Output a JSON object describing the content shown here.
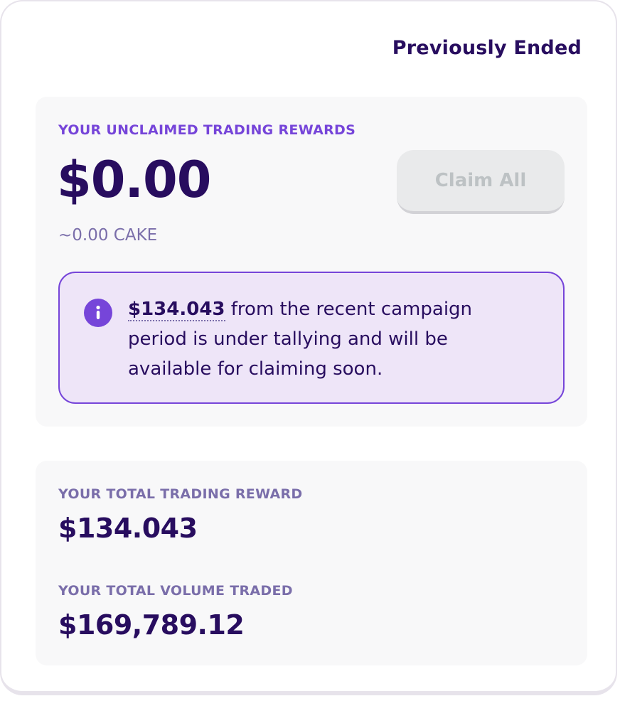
{
  "header": {
    "title": "Previously Ended"
  },
  "unclaimed": {
    "label": "YOUR  UNCLAIMED TRADING REWARDS",
    "amount_usd": "$0.00",
    "amount_cake": "~0.00 CAKE",
    "claim_button_label": "Claim All",
    "claim_button_disabled": true
  },
  "notice": {
    "icon": "info-icon",
    "amount": "$134.043",
    "text": " from the recent campaign period is under tallying and will be available for claiming soon."
  },
  "totals": {
    "reward_label": "YOUR  TOTAL TRADING REWARD",
    "reward_value": "$134.043",
    "volume_label": "YOUR  TOTAL VOLUME TRADED",
    "volume_value": "$169,789.12"
  },
  "colors": {
    "primary_text": "#280d5f",
    "accent_purple": "#7645d9",
    "muted_text": "#7a6eaa",
    "panel_bg": "#f8f8f9",
    "notice_bg": "#eee5f8",
    "disabled_button_bg": "#e9eaeb",
    "disabled_button_text": "#bdc2c4"
  }
}
